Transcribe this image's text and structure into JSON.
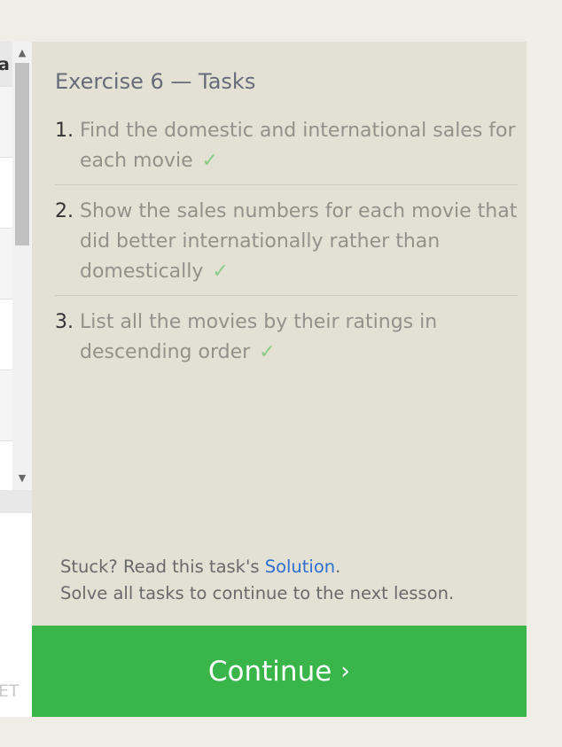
{
  "left_panel": {
    "header_fragment": "a",
    "reset_fragment": "ET"
  },
  "tasks": {
    "title": "Exercise 6 — Tasks",
    "check_glyph": "✓",
    "items": [
      {
        "number": "1.",
        "text": "Find the domestic and international sales for each movie"
      },
      {
        "number": "2.",
        "text": "Show the sales numbers for each movie that did better internationally rather than domestically"
      },
      {
        "number": "3.",
        "text": "List all the movies by their ratings in descending order"
      }
    ]
  },
  "footer": {
    "stuck_prefix": "Stuck? Read this task's ",
    "solution_link": "Solution",
    "stuck_suffix": ".",
    "continue_hint": "Solve all tasks to continue to the next lesson."
  },
  "continue_button": {
    "label": "Continue",
    "chevron": "›"
  },
  "colors": {
    "panel_bg": "#e3e0d4",
    "button_green": "#39b54a",
    "check_green": "#8acc8a",
    "link_blue": "#2f6fd1"
  }
}
